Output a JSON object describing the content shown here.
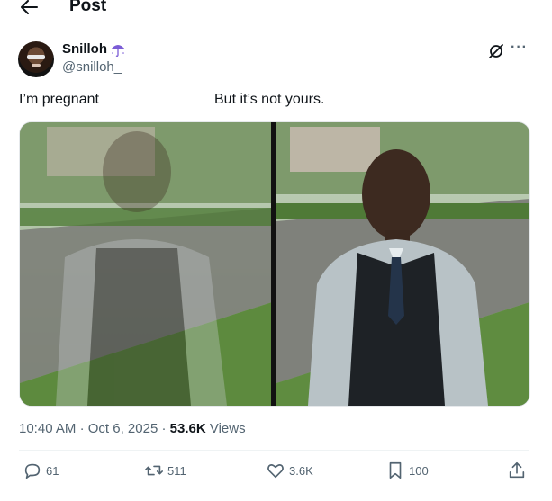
{
  "header": {
    "title": "Post"
  },
  "author": {
    "name": "Snilloh",
    "handle": "@snilloh_"
  },
  "post": {
    "text_left": "I’m pregnant",
    "text_right": "But it’s not yours."
  },
  "meta": {
    "time": "10:40 AM",
    "date": "Oct 6, 2025",
    "views_count": "53.6K",
    "views_label": "Views"
  },
  "actions": {
    "replies": "61",
    "reposts": "511",
    "likes": "3.6K",
    "bookmarks": "100"
  },
  "colors": {
    "text": "#0f1419",
    "secondary": "#536471",
    "divider": "#eff3f4",
    "umbrella": "#7b5cd6"
  },
  "icons": [
    "back-arrow-icon",
    "umbrella-icon",
    "grok-icon",
    "more-icon",
    "reply-icon",
    "repost-icon",
    "like-icon",
    "bookmark-icon",
    "share-icon"
  ]
}
